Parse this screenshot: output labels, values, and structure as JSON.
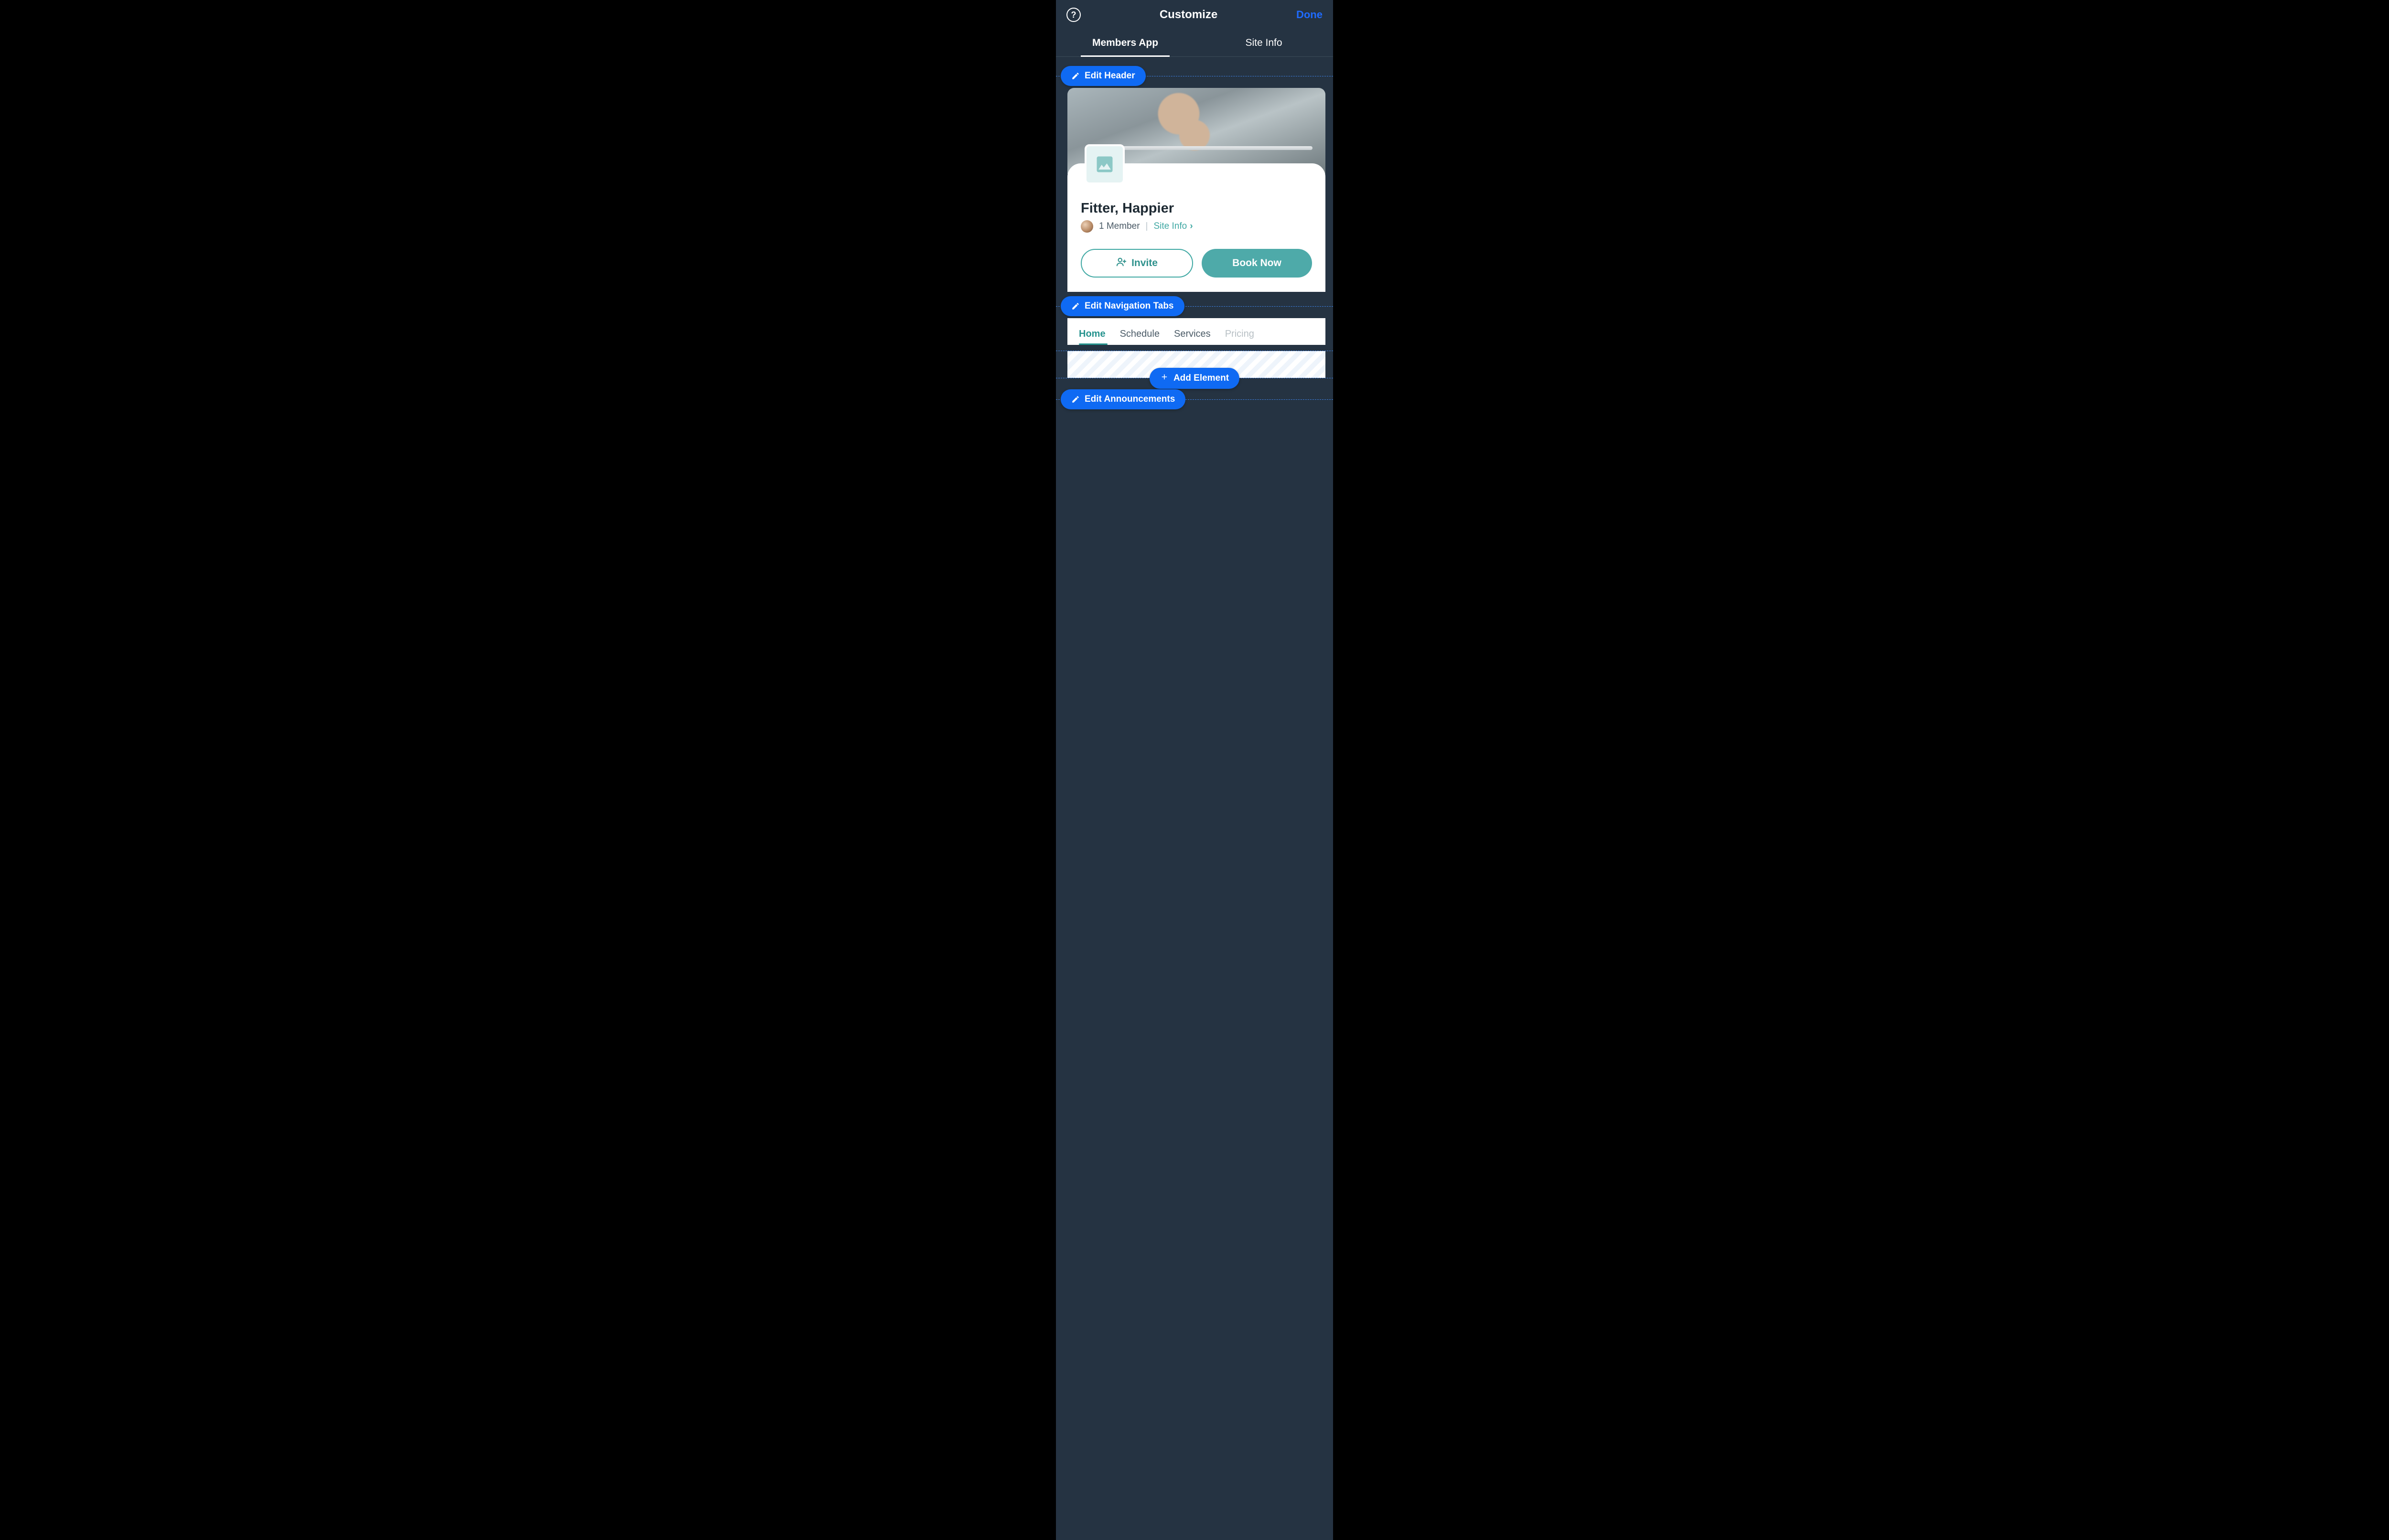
{
  "topbar": {
    "title": "Customize",
    "done_label": "Done"
  },
  "top_tabs": [
    {
      "label": "Members App",
      "active": true
    },
    {
      "label": "Site Info",
      "active": false
    }
  ],
  "edit_pills": {
    "header": "Edit Header",
    "nav_tabs": "Edit Navigation Tabs",
    "add_element": "Add Element",
    "announcements": "Edit Announcements"
  },
  "site": {
    "title": "Fitter, Happier",
    "member_count": "1 Member",
    "site_info_link": "Site Info"
  },
  "buttons": {
    "invite": "Invite",
    "book": "Book Now"
  },
  "nav_tabs": [
    {
      "label": "Home",
      "state": "active"
    },
    {
      "label": "Schedule",
      "state": "normal"
    },
    {
      "label": "Services",
      "state": "normal"
    },
    {
      "label": "Pricing",
      "state": "faded"
    }
  ],
  "colors": {
    "accent_blue": "#0f6af3",
    "done_blue": "#1f6bff",
    "teal": "#3fa8a3",
    "dark_bg": "#253342"
  }
}
